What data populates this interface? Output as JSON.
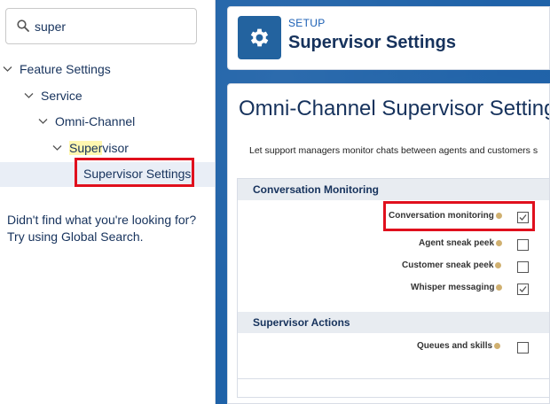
{
  "search": {
    "value": "super"
  },
  "tree": {
    "feature_settings": "Feature Settings",
    "service": "Service",
    "omni_channel": "Omni-Channel",
    "supervisor_highlight": "Super",
    "supervisor_rest": "visor",
    "supervisor_settings": "Supervisor Settings"
  },
  "help": {
    "line1": "Didn't find what you're looking for?",
    "line2": "Try using Global Search."
  },
  "header": {
    "setup_label": "SETUP",
    "title": "Supervisor Settings"
  },
  "content": {
    "title": "Omni-Channel Supervisor Settings",
    "description": "Let support managers monitor chats between agents and customers s"
  },
  "sections": [
    {
      "title": "Conversation Monitoring",
      "fields": [
        {
          "label": "Conversation monitoring",
          "checked": true
        },
        {
          "label": "Agent sneak peek",
          "checked": false
        },
        {
          "label": "Customer sneak peek",
          "checked": false
        },
        {
          "label": "Whisper messaging",
          "checked": true
        }
      ]
    },
    {
      "title": "Supervisor Actions",
      "fields": [
        {
          "label": "Queues and skills",
          "checked": false
        }
      ]
    }
  ],
  "colors": {
    "highlight_outline": "#e0101d",
    "brand_blue": "#1f62a8",
    "search_highlight": "#fff7b0"
  },
  "icons": [
    "search-icon",
    "chevron-down-icon",
    "gear-icon",
    "info-icon",
    "checkmark-icon"
  ]
}
